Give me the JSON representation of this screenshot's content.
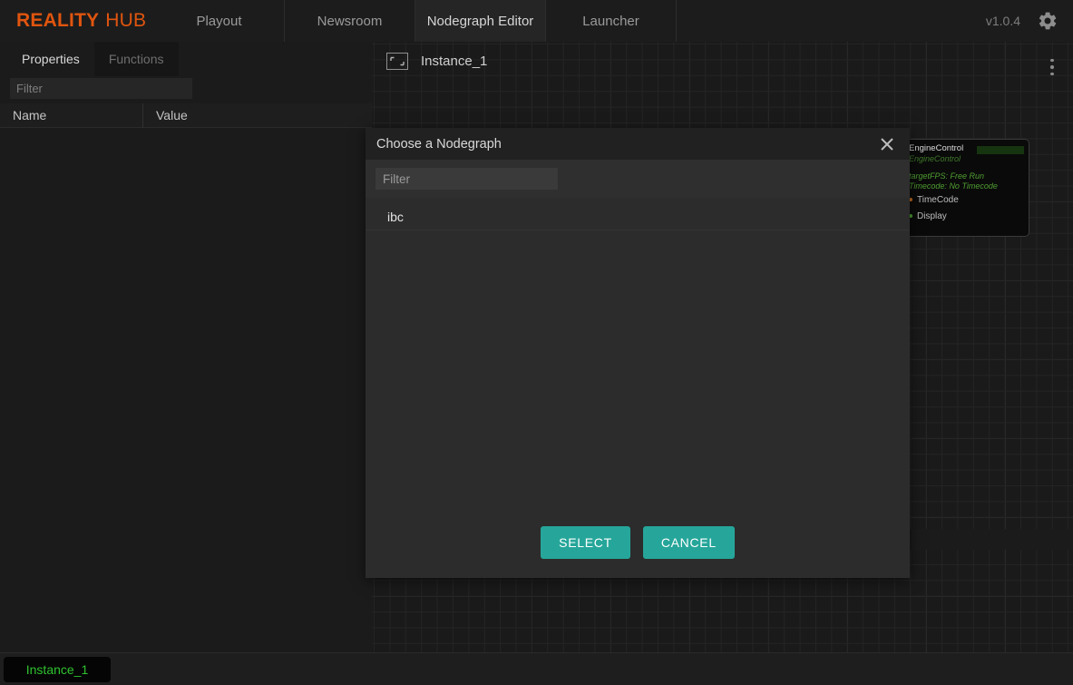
{
  "header": {
    "brand_primary": "REALITY",
    "brand_secondary": "HUB",
    "brand_color": "#e0550f",
    "tabs": [
      {
        "label": "Playout",
        "active": false
      },
      {
        "label": "Newsroom",
        "active": false
      },
      {
        "label": "Nodegraph Editor",
        "active": true
      },
      {
        "label": "Launcher",
        "active": false
      }
    ],
    "version": "v1.0.4",
    "settings_icon": "gear-icon"
  },
  "left_panel": {
    "tabs": [
      {
        "label": "Properties",
        "active": true
      },
      {
        "label": "Functions",
        "active": false
      }
    ],
    "filter_placeholder": "Filter",
    "filter_value": "",
    "columns": [
      "Name",
      "Value"
    ],
    "rows": []
  },
  "canvas": {
    "graph_name": "Instance_1",
    "graph_icon": "frame-icon",
    "menu_icon": "kebab-menu-icon",
    "node": {
      "title": "EngineControl",
      "subtitle": "EngineControl",
      "properties": [
        "targetFPS: Free Run",
        "Timecode: No Timecode"
      ],
      "ports": [
        {
          "label": "TimeCode",
          "color": "#c06a1e"
        },
        {
          "label": "Display",
          "color": "#46a02c"
        }
      ],
      "swatch_color": "#16340f"
    }
  },
  "modal": {
    "title": "Choose a Nodegraph",
    "close_icon": "close-icon",
    "filter_placeholder": "Filter",
    "filter_value": "",
    "items": [
      {
        "label": "ibc"
      }
    ],
    "select_label": "SELECT",
    "cancel_label": "CANCEL",
    "accent_color": "#26a69a"
  },
  "bottom_bar": {
    "instance_label": "Instance_1",
    "instance_color": "#2fc22f"
  }
}
